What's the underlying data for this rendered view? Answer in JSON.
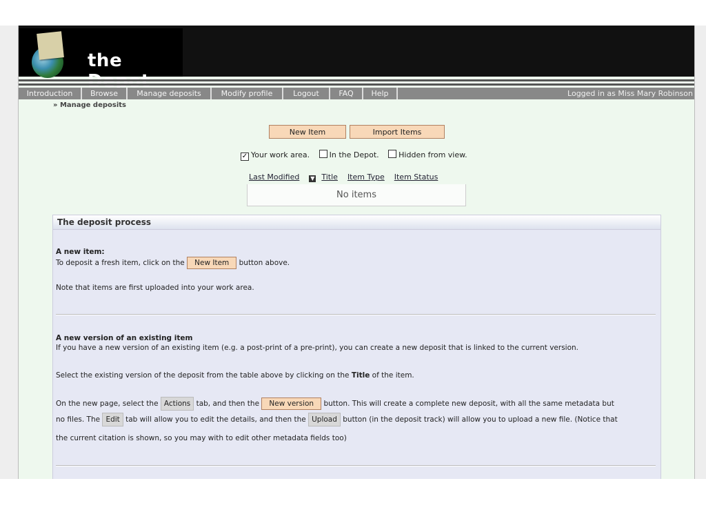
{
  "site": {
    "title": "the Depot"
  },
  "nav": {
    "items": [
      "Introduction",
      "Browse",
      "Manage deposits",
      "Modify profile",
      "Logout",
      "FAQ",
      "Help"
    ],
    "logged_in": "Logged in as Miss Mary Robinson"
  },
  "breadcrumb": "» Manage deposits",
  "actions": {
    "new_item": "New Item",
    "import_items": "Import Items"
  },
  "filters": [
    {
      "label": "Your work area.",
      "checked": true
    },
    {
      "label": "In the Depot.",
      "checked": false
    },
    {
      "label": "Hidden from view.",
      "checked": false
    }
  ],
  "columns": {
    "last_modified": "Last Modified",
    "title": "Title",
    "item_type": "Item Type",
    "item_status": "Item Status"
  },
  "items_empty": "No items",
  "help": {
    "heading": "The deposit process",
    "new_item_title": "A new item:",
    "new_item_text_before": "To deposit a fresh item, click on the",
    "new_item_button": "New Item",
    "new_item_text_after": "button above.",
    "note": "Note that items are first uploaded into your work area.",
    "new_version_title": "A new version of an existing item",
    "new_version_intro": "If you have a new version of an existing item (e.g. a post-print of a pre-print), you can create a new deposit that is linked to the current version.",
    "select_before": "Select the existing version of the deposit from the table above by clicking on the",
    "select_bold": "Title",
    "select_after": "of the item.",
    "line1_a": "On the new page, select the",
    "actions_tab": "Actions",
    "line1_b": "tab, and then the",
    "new_version_button": "New version",
    "line1_c": "button. This will create a complete new deposit, with all the same metadata but",
    "line2_a": "no files. The",
    "edit_tab": "Edit",
    "line2_b": "tab will allow you to edit the details, and then the",
    "upload_tab": "Upload",
    "line2_c": "button (in the deposit track) will allow you to upload a new file. (Notice that",
    "line3": "the current citation is shown, so you may with to edit other metadata fields too)"
  }
}
